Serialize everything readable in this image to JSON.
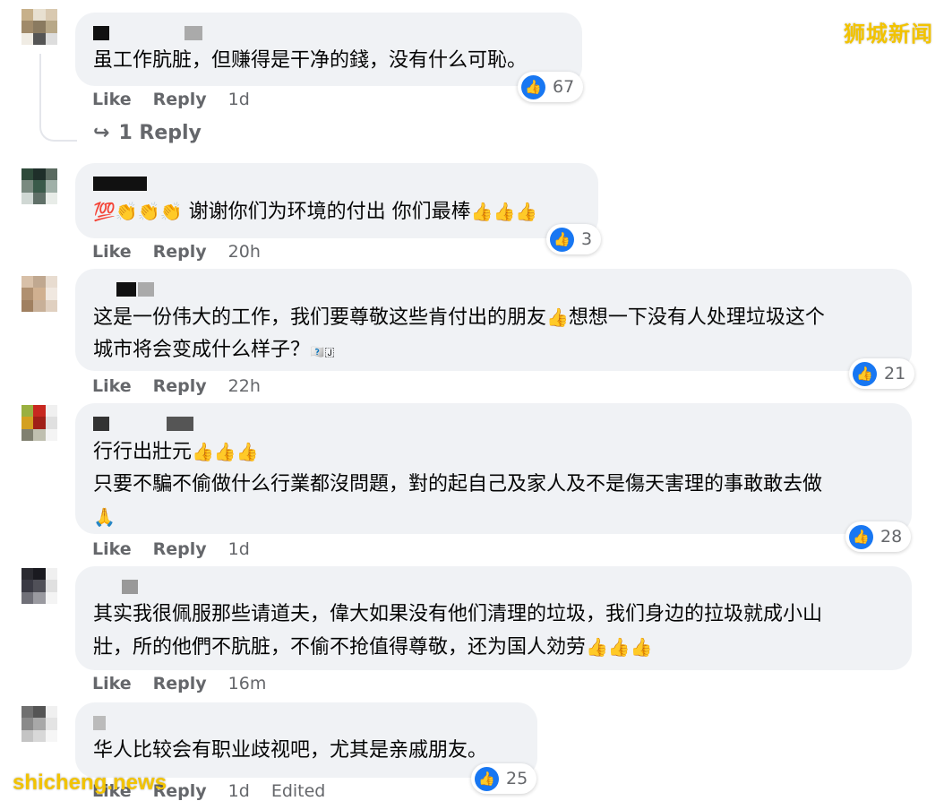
{
  "watermarks": {
    "top": "狮城新闻",
    "bottom": "shicheng.news"
  },
  "actions": {
    "like": "Like",
    "reply": "Reply"
  },
  "colors": {
    "accent": "#1877f2",
    "bubble": "#f0f2f5",
    "meta": "#65676b",
    "watermark": "#f2c300"
  },
  "comments": [
    {
      "text": "虽工作肮脏，但赚得是干净的錢，没有什么可恥。",
      "reactions": "67",
      "time": "1d",
      "replies_label": "1 Reply"
    },
    {
      "emoji_prefix": "💯👏👏👏",
      "text": "谢谢你们为环境的付出 你们最棒",
      "emoji_suffix": "👍👍👍",
      "reactions": "3",
      "time": "20h"
    },
    {
      "text_line1": "这是一份伟大的工作，我们要尊敬这些肯付出的朋友",
      "emoji_mid": "👍",
      "text_line1b": "想想一下没有人处理垃圾这个",
      "text_line2": "城市将会变成什么样子？",
      "emoji_suffix": "🇴🇧🇯",
      "reactions": "21",
      "time": "22h"
    },
    {
      "text_line1": "行行出壯元",
      "emoji_line1": "👍👍👍",
      "text_line2": "只要不騙不偷做什么行業都沒問題，對的起自己及家人及不是傷天害理的事敢敢去做",
      "emoji_line3": "🙏",
      "reactions": "28",
      "time": "1d"
    },
    {
      "text_line1": "其实我很佩服那些请道夫，偉大如果没有他们清理的垃圾，我们身边的拉圾就成小山",
      "text_line2": "壯，所的他們不肮脏，不偷不抢值得尊敬，还为国人効劳",
      "emoji_suffix": "👍👍👍",
      "time": "16m"
    },
    {
      "text": "华人比较会有职业歧视吧，尤其是亲戚朋友。",
      "reactions": "25",
      "time": "1d",
      "edited": "Edited"
    }
  ],
  "icons": {
    "reply_arrow": "reply-arrow-icon",
    "like": "thumbs-up-icon"
  }
}
